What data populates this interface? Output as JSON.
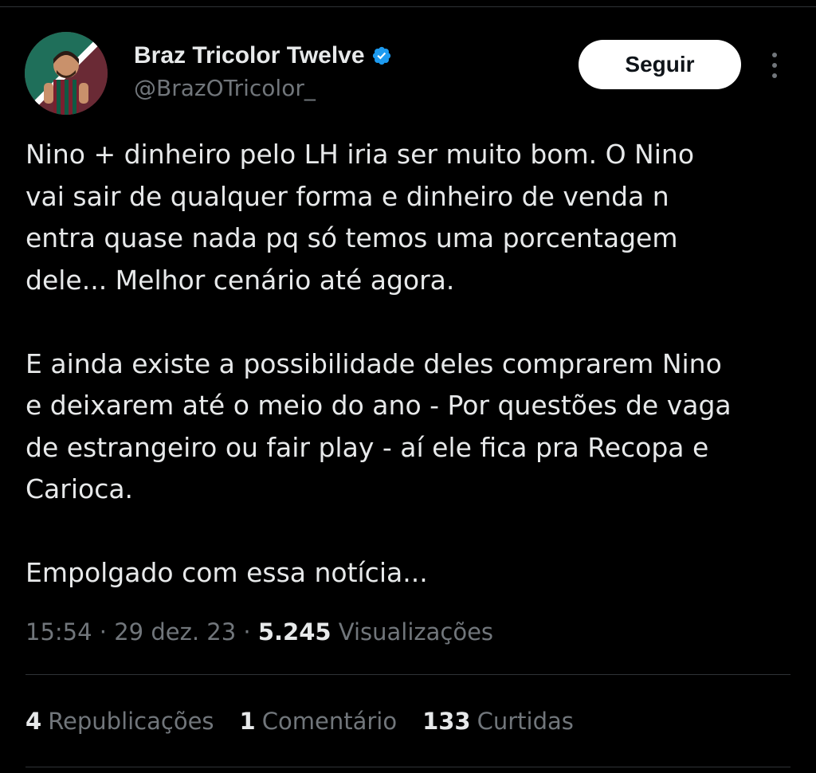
{
  "author": {
    "name": "Braz Tricolor Twelve",
    "handle": "@BrazOTricolor_",
    "verified": true
  },
  "actions": {
    "follow_label": "Seguir"
  },
  "tweet": {
    "paragraphs": [
      {
        "lines": [
          "Nino + dinheiro pelo LH iria ser muito bom. O Nino",
          "vai sair de qualquer forma e dinheiro de venda n",
          "entra quase nada pq só temos uma porcentagem",
          "dele... Melhor cenário até agora."
        ]
      },
      {
        "lines": [
          "E ainda existe a possibilidade deles comprarem Nino",
          "e deixarem até o meio do ano - Por questões de vaga",
          "de estrangeiro ou fair play - aí ele fica pra Recopa e",
          "Carioca."
        ]
      },
      {
        "lines": [
          "Empolgado com essa notícia..."
        ]
      }
    ]
  },
  "meta": {
    "time": "15:54",
    "sep1": " · ",
    "date": "29 dez. 23",
    "sep2": " · ",
    "views_count": "5.245",
    "views_label": " Visualizações"
  },
  "stats": {
    "reposts_count": "4",
    "reposts_label": "Republicações",
    "comments_count": "1",
    "comments_label": "Comentário",
    "likes_count": "133",
    "likes_label": "Curtidas"
  },
  "colors": {
    "background": "#000000",
    "text_primary": "#e7e9ea",
    "text_secondary": "#71767b",
    "verified_blue": "#1d9bf0",
    "divider": "#2f3336"
  },
  "icons": {
    "verified": "verified-badge-icon",
    "more": "more-options-icon"
  }
}
